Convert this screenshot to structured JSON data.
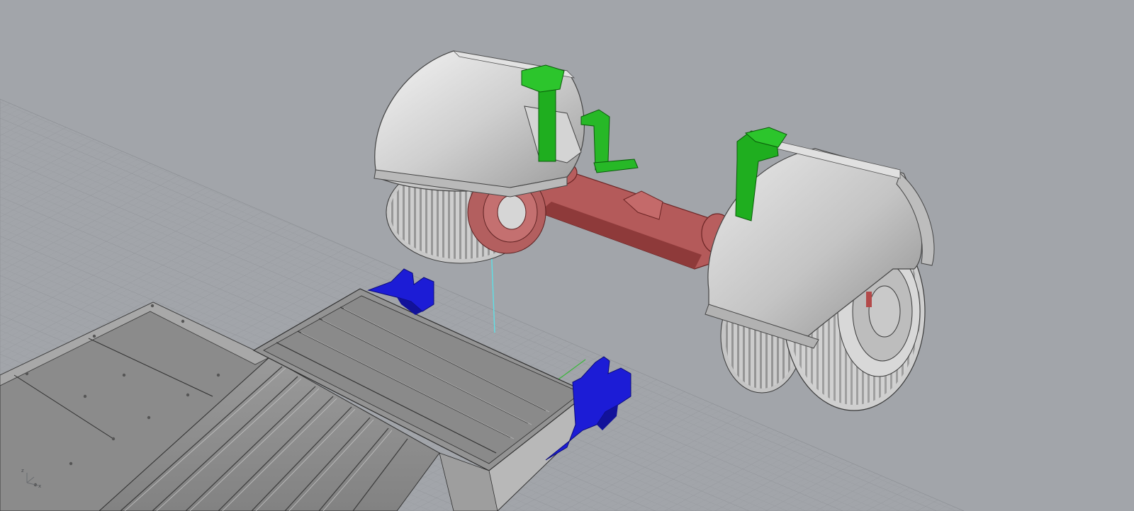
{
  "viewport": {
    "name": "Perspective",
    "background_color": "#a2a5aa",
    "grid_color": "#8d9095"
  },
  "axis_indicator": {
    "z_label": "z",
    "x_label": "x"
  },
  "objects": [
    {
      "name": "axle-beam",
      "color": "#a04848"
    },
    {
      "name": "wheel-left",
      "color": "#c9c9c9"
    },
    {
      "name": "wheel-right",
      "color": "#c9c9c9"
    },
    {
      "name": "jack-left",
      "color": "#22b022"
    },
    {
      "name": "jack-right",
      "color": "#22b022"
    },
    {
      "name": "bracket-left",
      "color": "#1d1dd4"
    },
    {
      "name": "bracket-right",
      "color": "#1d1dd4"
    },
    {
      "name": "trailer-bed",
      "color": "#8e8e8e"
    }
  ]
}
